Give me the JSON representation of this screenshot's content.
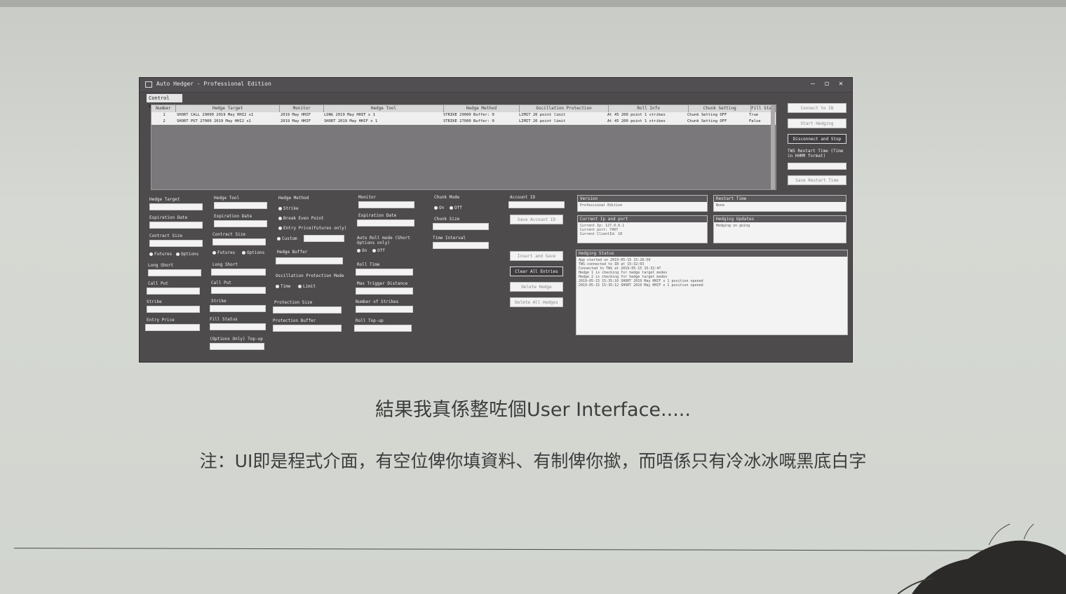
{
  "window": {
    "title": "Auto Hedger - Professional Edition",
    "tab": "Control Panel",
    "controls": [
      "—",
      "◻",
      "✕"
    ]
  },
  "grid": {
    "columns": [
      "Number",
      "Hedge Target",
      "Monitor",
      "Hedge Tool",
      "Hedge Method",
      "Oscillation Protection",
      "Roll Info",
      "Chunk Setting",
      "Fill Status"
    ],
    "rows": [
      [
        "1",
        "SHORT CALL 29000 2019 May HHI2 x1",
        "2019 May HHIF",
        "LONG 2019 May HHIF x 1",
        "STRIKE 29000 Buffer: 0",
        "LIMIT 20 point limit",
        "At 45 200 point 1 strikes",
        "Chunk Setting OFF",
        "True"
      ],
      [
        "2",
        "SHORT PUT 27000 2019 May HHI2 x1",
        "2019 May HHIF",
        "SHORT 2019 May HHIF x 1",
        "STRIKE 27000 Buffer: 0",
        "LIMIT 20 point limit",
        "At 45 200 point 1 strikes",
        "Chunk Setting OFF",
        "False"
      ]
    ]
  },
  "side_buttons": [
    "Connect to IB",
    "Start Hedging",
    "Disconnect and Stop",
    "TWS Restart Time (Time in HHMM format)",
    "Save Restart Time"
  ],
  "form": {
    "col1": [
      "Hedge Target",
      "Expiration Date",
      "Contract Size",
      "Long Short",
      "Call Put",
      "Strike",
      "Entry Price"
    ],
    "col1_radio": [
      "Futures",
      "Options"
    ],
    "col2": [
      "Hedge Tool",
      "Expiration Date",
      "Contract Size",
      "Long Short",
      "Call Put",
      "Strike",
      "Fill Status",
      "(Options Only) Top-up"
    ],
    "col2_radio": [
      "Futures",
      "Options"
    ],
    "col3_title": "Hedge Method",
    "col3_radio": [
      "Strike",
      "Break Even Point",
      "Entry Price(Futures only)",
      "Custom"
    ],
    "col3": [
      "Hedge Buffer",
      "Oscillation Protection Mode",
      "Protection Size",
      "Protection Buffer"
    ],
    "col3_osc_radio": [
      "Time",
      "Limit"
    ],
    "col4": [
      "Monitor",
      "Expiration Date",
      "Auto Roll mode (Short Options only)",
      "Roll Time",
      "Max Trigger Distance",
      "Number of Strikes",
      "Roll Top-up"
    ],
    "col4_radio": [
      "On",
      "Off"
    ],
    "col5": [
      "Chunk Mode",
      "Chunk Size",
      "Time Interval"
    ],
    "col5_radio": [
      "On",
      "Off"
    ],
    "col6": [
      "Account ID"
    ],
    "col6_buttons": [
      "Save Account ID",
      "Insert and Save",
      "Clear All Entries",
      "Delete Hedge",
      "Delete All Hedges"
    ]
  },
  "status_boxes": {
    "version": {
      "title": "Version",
      "text": "Professional Edition"
    },
    "restart": {
      "title": "Restart Time",
      "text": "None"
    },
    "current_ip": {
      "title": "Current Ip and port",
      "text": "Current Ip: 127.0.0.1\nCurrent port: 7497\nCurrent ClientId: 10"
    },
    "hedging_update": {
      "title": "Hedging Updates",
      "text": "Hedging on going"
    },
    "hedging_status": {
      "title": "Hedging Status",
      "text": "App started on 2019-05-15 15:28:50\nTWS connected to IB at 15:32:03\nConnected to TWS at 2019-05-15 15:32:47\nHedge 1 is checking for hedge target modes\nHedge 2 is checking for hedge target modes\n2019-05-15 15:35:10 SHORT 2019 May HHIF x 1 position opened\n2019-05-15 15:35:12 SHORT 2019 May HHIF x 1 position opened"
    }
  },
  "captions": {
    "line1": "結果我真係整咗個User Interface.....",
    "line2": "注：UI即是程式介面，有空位俾你填資料、有制俾你撳，而唔係只有冷冰冰嘅黑底白字"
  }
}
